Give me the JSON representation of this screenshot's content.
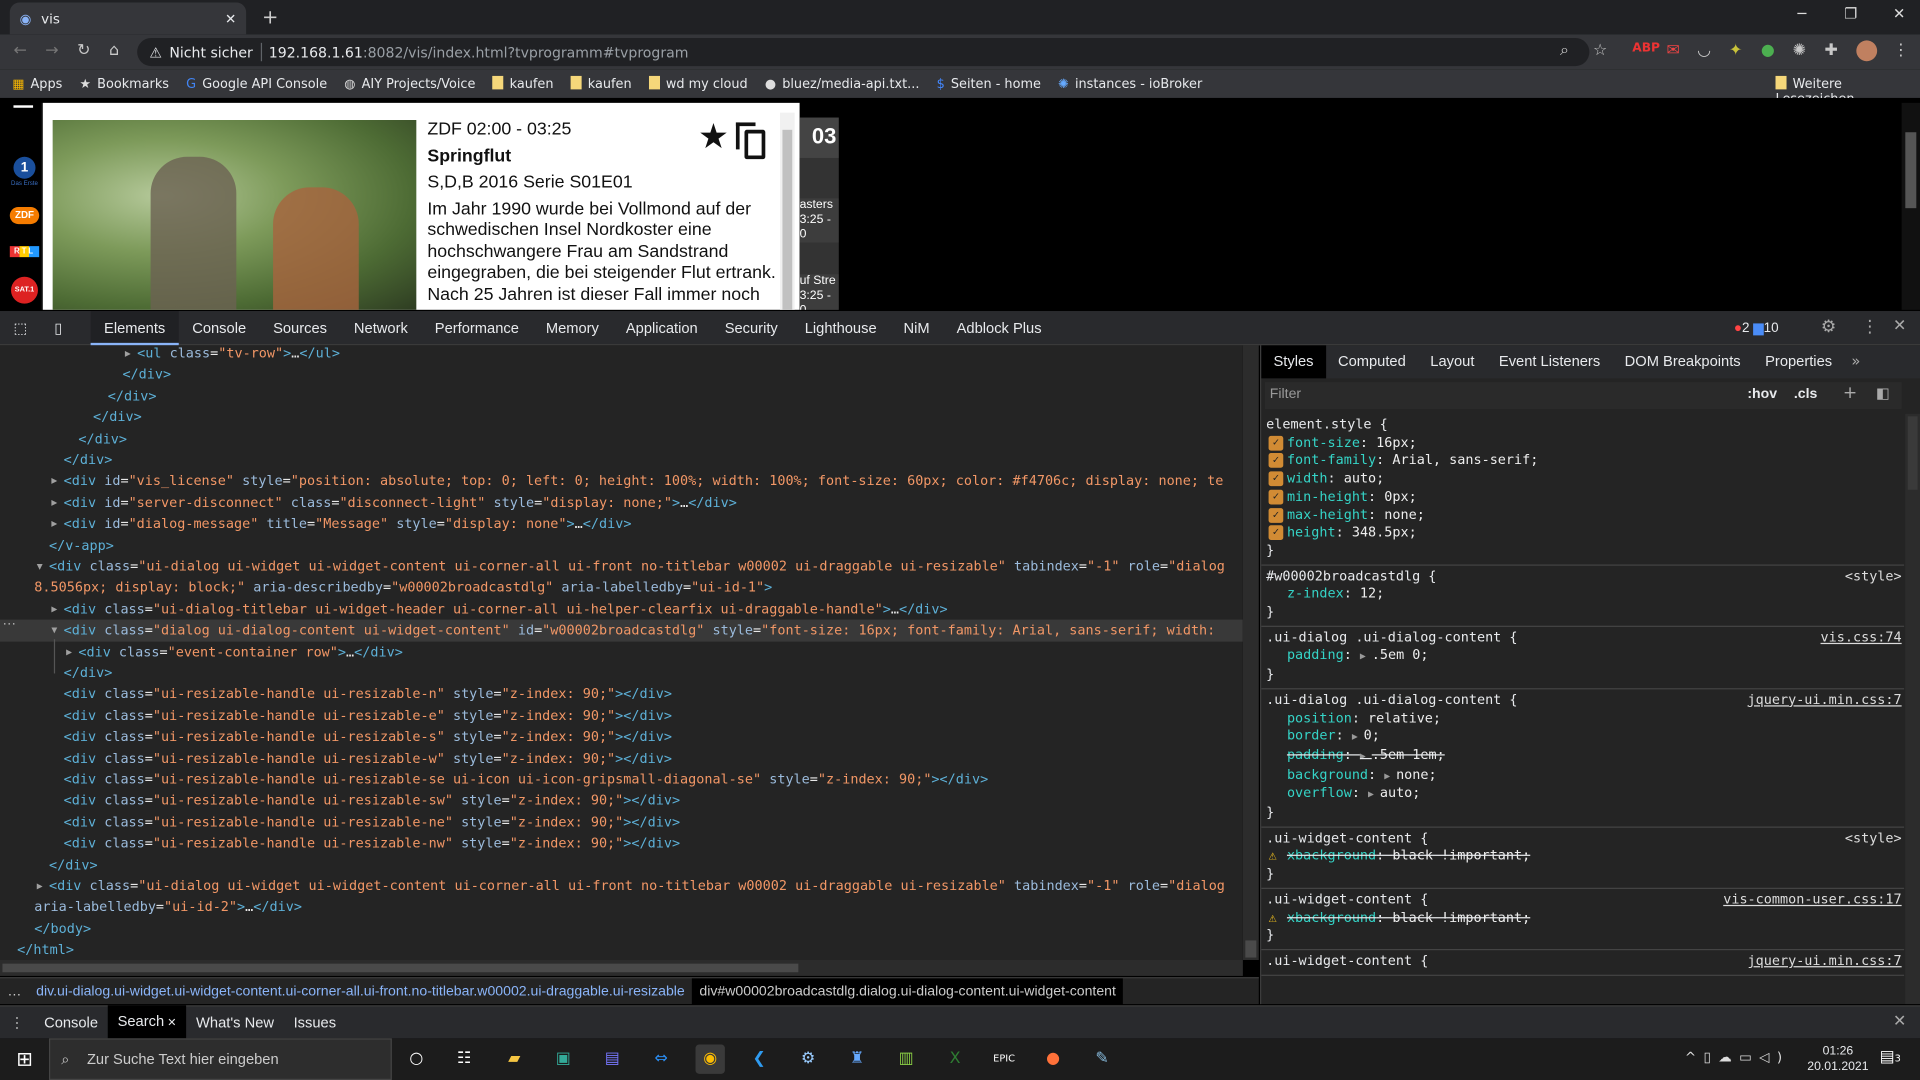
{
  "browser": {
    "tab_title": "vis",
    "security_label": "Nicht sicher",
    "url_host": "192.168.1.61",
    "url_rest": ":8082/vis/index.html?tvprogramm#tvprogram",
    "bookmarks": [
      {
        "icon": "apps-icon",
        "label": "Apps"
      },
      {
        "icon": "star-icon",
        "label": "Bookmarks"
      },
      {
        "icon": "google-icon",
        "label": "Google API Console"
      },
      {
        "icon": "globe-icon",
        "label": "AIY Projects/Voice"
      },
      {
        "icon": "folder-icon",
        "label": "kaufen"
      },
      {
        "icon": "folder-icon",
        "label": "kaufen"
      },
      {
        "icon": "folder-icon",
        "label": "wd my cloud"
      },
      {
        "icon": "github-icon",
        "label": "bluez/media-api.txt..."
      },
      {
        "icon": "site-icon",
        "label": "Seiten - home"
      },
      {
        "icon": "iobroker-icon",
        "label": "instances - ioBroker"
      }
    ],
    "other_bookmarks": "Weitere Lesezeichen"
  },
  "page": {
    "broadcast": {
      "channel_time": "ZDF 02:00 - 03:25",
      "title": "Springflut",
      "meta": "S,D,B 2016 Serie S01E01",
      "description": "Im Jahr 1990 wurde bei Vollmond auf der schwedischen Insel Nordkoster eine hochschwangere Frau am Sandstrand eingegraben, die bei steigender Flut ertrank. Nach 25 Jahren ist dieser Fall immer noch"
    },
    "tv_column": {
      "hour": "03",
      "row1_title": "asters",
      "row1_time": "3:25 - 0",
      "row2_title": "uf Stre",
      "row2_time": "3:25 - 0"
    },
    "channels": [
      "Das Erste",
      "ZDF",
      "RTL",
      "SAT.1"
    ]
  },
  "devtools": {
    "tabs": [
      "Elements",
      "Console",
      "Sources",
      "Network",
      "Performance",
      "Memory",
      "Application",
      "Security",
      "Lighthouse",
      "NiM",
      "Adblock Plus"
    ],
    "active_tab": "Elements",
    "error_count": "2",
    "message_count": "10",
    "dom_lines": [
      {
        "i": 112,
        "arrow": "▶",
        "code": "<ul class=\"tv-row\">…</ul>"
      },
      {
        "i": 100,
        "code": "</div>"
      },
      {
        "i": 88,
        "code": "</div>"
      },
      {
        "i": 76,
        "code": "</div>"
      },
      {
        "i": 64,
        "code": "</div>"
      },
      {
        "i": 52,
        "code": "</div>"
      },
      {
        "i": 52,
        "arrow": "▶",
        "code": "<div id=\"vis_license\" style=\"position: absolute; top: 0; left: 0; height: 100%; width: 100%; font-size: 60px; color: #f4706c; display: none; te"
      },
      {
        "i": 52,
        "arrow": "▶",
        "code": "<div id=\"server-disconnect\" class=\"disconnect-light\" style=\"display: none;\">…</div>"
      },
      {
        "i": 52,
        "arrow": "▶",
        "code": "<div id=\"dialog-message\" title=\"Message\" style=\"display: none\">…</div>"
      },
      {
        "i": 40,
        "code": "</v-app>"
      },
      {
        "i": 40,
        "arrow": "▼",
        "code": "<div class=\"ui-dialog ui-widget ui-widget-content ui-corner-all ui-front no-titlebar w00002 ui-draggable ui-resizable\" tabindex=\"-1\" role=\"dialog"
      },
      {
        "i": 28,
        "cont": true,
        "code": "8.5056px; display: block;\" aria-describedby=\"w00002broadcastdlg\" aria-labelledby=\"ui-id-1\">"
      },
      {
        "i": 52,
        "arrow": "▶",
        "code": "<div class=\"ui-dialog-titlebar ui-widget-header ui-corner-all ui-helper-clearfix ui-draggable-handle\">…</div>"
      },
      {
        "i": 52,
        "arrow": "▼",
        "selected": true,
        "code": "<div class=\"dialog ui-dialog-content ui-widget-content\" id=\"w00002broadcastdlg\" style=\"font-size: 16px; font-family: Arial, sans-serif; width:"
      },
      {
        "i": 64,
        "arrow": "▶",
        "code": "<div class=\"event-container row\">…</div>"
      },
      {
        "i": 52,
        "code": "</div>"
      },
      {
        "i": 52,
        "code": "<div class=\"ui-resizable-handle ui-resizable-n\" style=\"z-index: 90;\"></div>"
      },
      {
        "i": 52,
        "code": "<div class=\"ui-resizable-handle ui-resizable-e\" style=\"z-index: 90;\"></div>"
      },
      {
        "i": 52,
        "code": "<div class=\"ui-resizable-handle ui-resizable-s\" style=\"z-index: 90;\"></div>"
      },
      {
        "i": 52,
        "code": "<div class=\"ui-resizable-handle ui-resizable-w\" style=\"z-index: 90;\"></div>"
      },
      {
        "i": 52,
        "code": "<div class=\"ui-resizable-handle ui-resizable-se ui-icon ui-icon-gripsmall-diagonal-se\" style=\"z-index: 90;\"></div>"
      },
      {
        "i": 52,
        "code": "<div class=\"ui-resizable-handle ui-resizable-sw\" style=\"z-index: 90;\"></div>"
      },
      {
        "i": 52,
        "code": "<div class=\"ui-resizable-handle ui-resizable-ne\" style=\"z-index: 90;\"></div>"
      },
      {
        "i": 52,
        "code": "<div class=\"ui-resizable-handle ui-resizable-nw\" style=\"z-index: 90;\"></div>"
      },
      {
        "i": 40,
        "code": "</div>"
      },
      {
        "i": 40,
        "arrow": "▶",
        "code": "<div class=\"ui-dialog ui-widget ui-widget-content ui-corner-all ui-front no-titlebar w00002 ui-draggable ui-resizable\" tabindex=\"-1\" role=\"dialog"
      },
      {
        "i": 28,
        "cont": true,
        "code": "aria-labelledby=\"ui-id-2\">…</div>"
      },
      {
        "i": 28,
        "code": "</body>"
      },
      {
        "i": 14,
        "code": "</html>"
      }
    ],
    "breadcrumbs": [
      "div.ui-dialog.ui-widget.ui-widget-content.ui-corner-all.ui-front.no-titlebar.w00002.ui-draggable.ui-resizable",
      "div#w00002broadcastdlg.dialog.ui-dialog-content.ui-widget-content"
    ],
    "sidebar_tabs": [
      "Styles",
      "Computed",
      "Layout",
      "Event Listeners",
      "DOM Breakpoints",
      "Properties"
    ],
    "filter_placeholder": "Filter",
    "hov": ":hov",
    "cls": ".cls",
    "rules": [
      {
        "selector": "element.style {",
        "source": "",
        "decls": [
          {
            "mark": "check",
            "name": "font-size",
            "value": "16px;"
          },
          {
            "mark": "check",
            "name": "font-family",
            "value": "Arial, sans-serif;"
          },
          {
            "mark": "check",
            "name": "width",
            "value": "auto;"
          },
          {
            "mark": "check",
            "name": "min-height",
            "value": "0px;"
          },
          {
            "mark": "check",
            "name": "max-height",
            "value": "none;"
          },
          {
            "mark": "check",
            "name": "height",
            "value": "348.5px;"
          }
        ]
      },
      {
        "selector": "#w00002broadcastdlg {",
        "source": "<style>",
        "decls": [
          {
            "name": "z-index",
            "value": "12;"
          }
        ]
      },
      {
        "selector": ".ui-dialog .ui-dialog-content {",
        "source": "vis.css:74",
        "link": true,
        "decls": [
          {
            "name": "padding",
            "expand": true,
            "value": ".5em 0;"
          }
        ]
      },
      {
        "selector": ".ui-dialog .ui-dialog-content {",
        "source": "jquery-ui.min.css:7",
        "link": true,
        "decls": [
          {
            "name": "position",
            "value": "relative;"
          },
          {
            "name": "border",
            "expand": true,
            "value": "0;"
          },
          {
            "name": "padding",
            "expand": true,
            "value": ".5em 1em;",
            "struck": true
          },
          {
            "name": "background",
            "expand": true,
            "value": "none;"
          },
          {
            "name": "overflow",
            "expand": true,
            "value": "auto;"
          }
        ]
      },
      {
        "selector": ".ui-widget-content {",
        "source": "<style>",
        "decls": [
          {
            "mark": "warn",
            "name": "xbackground",
            "value": "black !important;",
            "struck": true
          }
        ]
      },
      {
        "selector": ".ui-widget-content {",
        "source": "vis-common-user.css:17",
        "link": true,
        "decls": [
          {
            "mark": "warn",
            "name": "xbackground",
            "value": "black !important;",
            "struck": true
          }
        ]
      },
      {
        "selector": ".ui-widget-content {",
        "source": "jquery-ui.min.css:7",
        "link": true,
        "decls": []
      }
    ],
    "drawer_tabs": [
      "Console",
      "Search",
      "What's New",
      "Issues"
    ],
    "drawer_active": "Search"
  },
  "taskbar": {
    "search_placeholder": "Zur Suche Text hier eingeben",
    "time": "01:26",
    "date": "20.01.2021",
    "notifications": "3"
  }
}
